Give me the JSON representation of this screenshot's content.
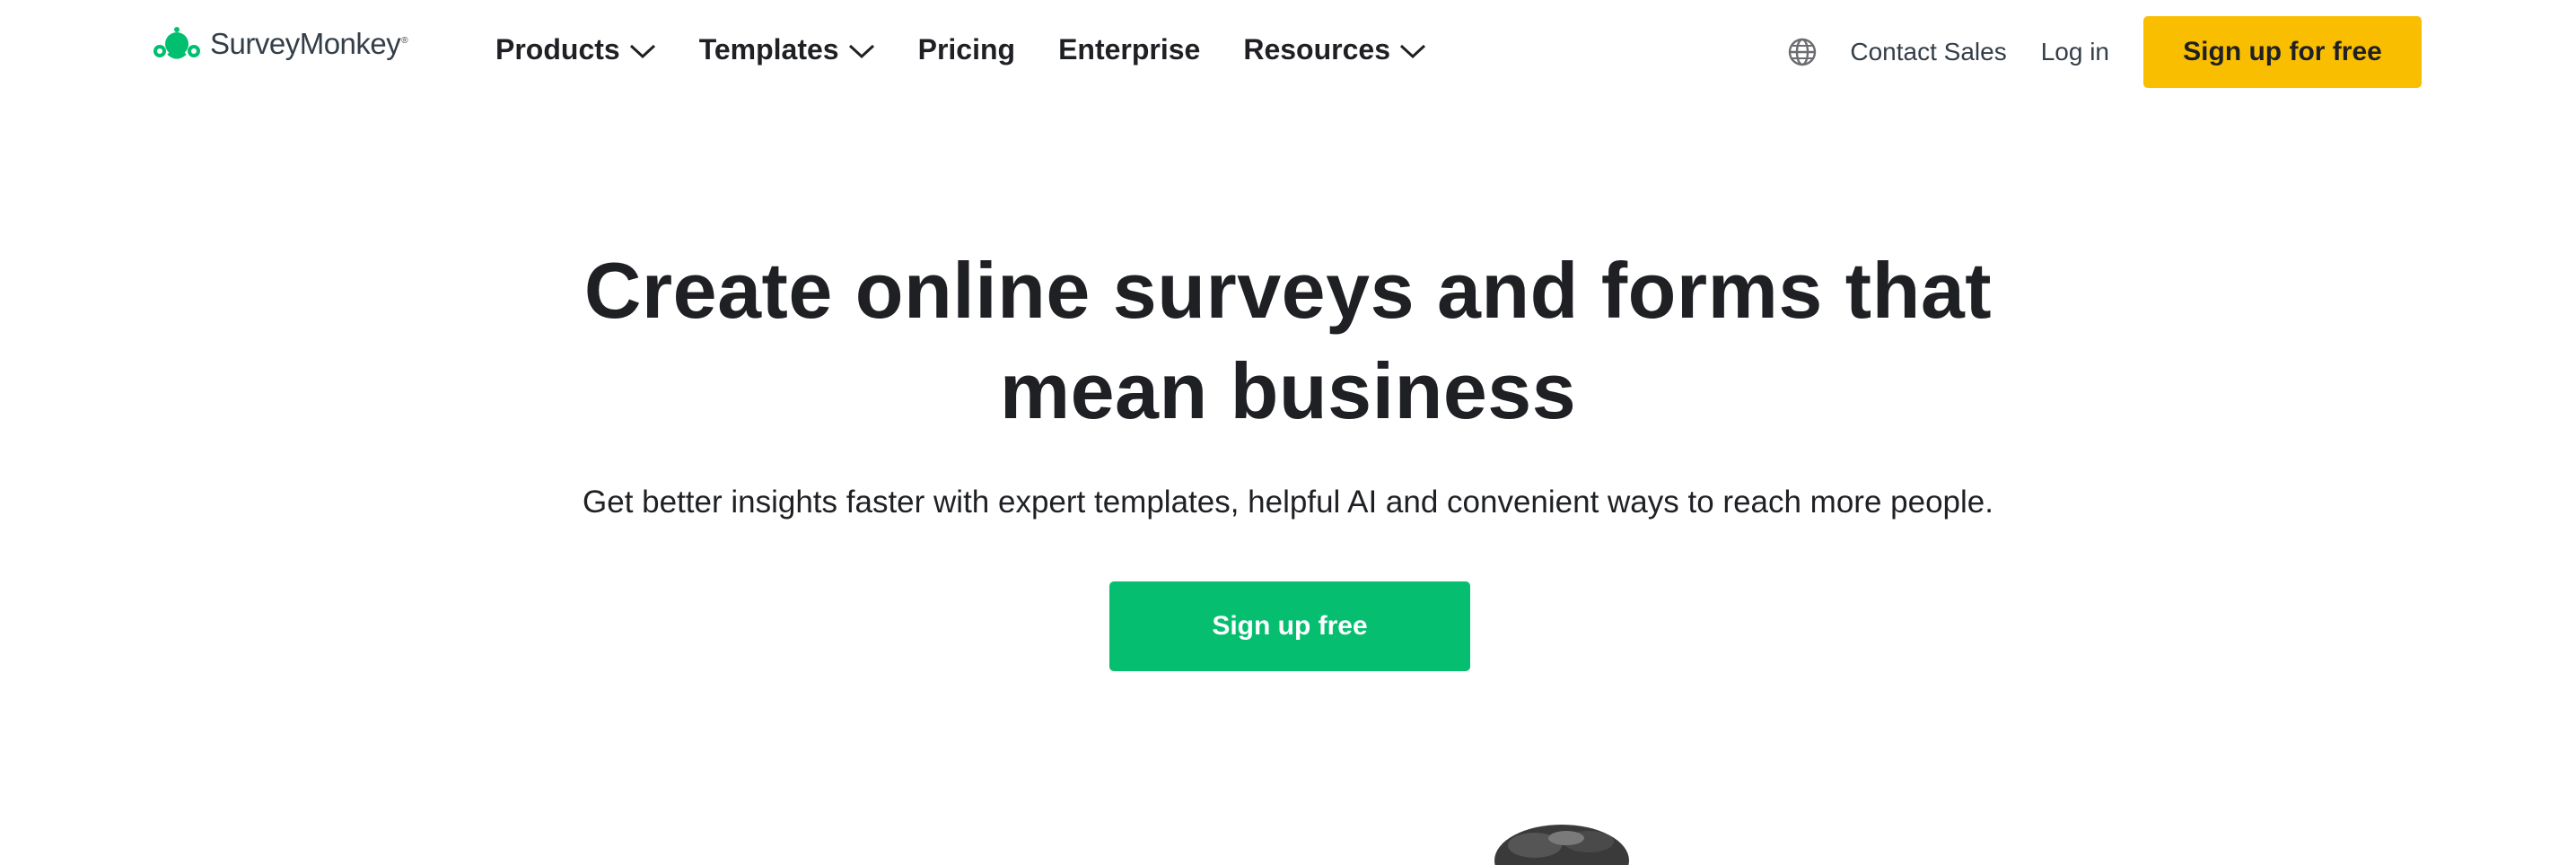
{
  "brand": {
    "name": "SurveyMonkey",
    "registered_mark": "®",
    "color": "#00bf6f"
  },
  "nav": {
    "items": [
      {
        "label": "Products",
        "icon": "chevron-down-icon"
      },
      {
        "label": "Templates",
        "icon": "chevron-down-icon"
      },
      {
        "label": "Pricing"
      },
      {
        "label": "Enterprise"
      },
      {
        "label": "Resources",
        "icon": "chevron-down-icon"
      }
    ]
  },
  "header_right": {
    "globe_icon": "globe-icon",
    "contact_sales": "Contact Sales",
    "login": "Log in",
    "signup": "Sign up for free",
    "signup_color": "#f9be00"
  },
  "hero": {
    "title_line1": "Create online surveys and forms that",
    "title_line2": "mean business",
    "subtitle": "Get better insights faster with expert templates, helpful AI and convenient ways to reach more people.",
    "cta": "Sign up free",
    "cta_color": "#05be70"
  }
}
